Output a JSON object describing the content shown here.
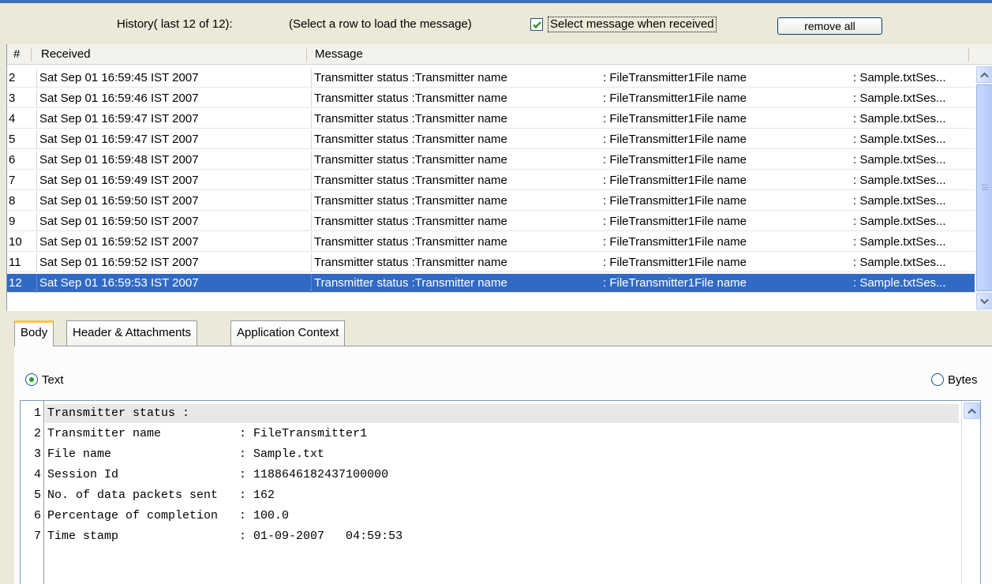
{
  "history": {
    "title": "History( last 12 of 12):",
    "hint": "(Select a row to load the message)",
    "select_checkbox_label": "Select message when received",
    "select_checked": true,
    "remove_all_label": "remove all"
  },
  "table": {
    "columns": [
      "#",
      "Received",
      "Message"
    ],
    "rows": [
      {
        "num": "2",
        "received": "Sat Sep 01 16:59:45 IST 2007",
        "m1": "Transmitter status :Transmitter name",
        "m2": ": FileTransmitter1File name",
        "m3": ": Sample.txtSes..."
      },
      {
        "num": "3",
        "received": "Sat Sep 01 16:59:46 IST 2007",
        "m1": "Transmitter status :Transmitter name",
        "m2": ": FileTransmitter1File name",
        "m3": ": Sample.txtSes..."
      },
      {
        "num": "4",
        "received": "Sat Sep 01 16:59:47 IST 2007",
        "m1": "Transmitter status :Transmitter name",
        "m2": ": FileTransmitter1File name",
        "m3": ": Sample.txtSes..."
      },
      {
        "num": "5",
        "received": "Sat Sep 01 16:59:47 IST 2007",
        "m1": "Transmitter status :Transmitter name",
        "m2": ": FileTransmitter1File name",
        "m3": ": Sample.txtSes..."
      },
      {
        "num": "6",
        "received": "Sat Sep 01 16:59:48 IST 2007",
        "m1": "Transmitter status :Transmitter name",
        "m2": ": FileTransmitter1File name",
        "m3": ": Sample.txtSes..."
      },
      {
        "num": "7",
        "received": "Sat Sep 01 16:59:49 IST 2007",
        "m1": "Transmitter status :Transmitter name",
        "m2": ": FileTransmitter1File name",
        "m3": ": Sample.txtSes..."
      },
      {
        "num": "8",
        "received": "Sat Sep 01 16:59:50 IST 2007",
        "m1": "Transmitter status :Transmitter name",
        "m2": ": FileTransmitter1File name",
        "m3": ": Sample.txtSes..."
      },
      {
        "num": "9",
        "received": "Sat Sep 01 16:59:50 IST 2007",
        "m1": "Transmitter status :Transmitter name",
        "m2": ": FileTransmitter1File name",
        "m3": ": Sample.txtSes..."
      },
      {
        "num": "10",
        "received": "Sat Sep 01 16:59:52 IST 2007",
        "m1": "Transmitter status :Transmitter name",
        "m2": ": FileTransmitter1File name",
        "m3": ": Sample.txtSes..."
      },
      {
        "num": "11",
        "received": "Sat Sep 01 16:59:52 IST 2007",
        "m1": "Transmitter status :Transmitter name",
        "m2": ": FileTransmitter1File name",
        "m3": ": Sample.txtSes..."
      },
      {
        "num": "12",
        "received": "Sat Sep 01 16:59:53 IST 2007",
        "m1": "Transmitter status :Transmitter name",
        "m2": ": FileTransmitter1File name",
        "m3": ": Sample.txtSes...",
        "selected": true
      }
    ]
  },
  "tabs": [
    {
      "label": "Body",
      "active": true
    },
    {
      "label": "Header & Attachments",
      "active": false
    },
    {
      "label": "Application Context",
      "active": false
    }
  ],
  "format": {
    "text_label": "Text",
    "bytes_label": "Bytes",
    "selected": "Text"
  },
  "body": {
    "lines": [
      {
        "num": "1",
        "text": "Transmitter status :"
      },
      {
        "num": "2",
        "text": "Transmitter name           : FileTransmitter1"
      },
      {
        "num": "3",
        "text": "File name                  : Sample.txt"
      },
      {
        "num": "4",
        "text": "Session Id                 : 1188646182437100000"
      },
      {
        "num": "5",
        "text": "No. of data packets sent   : 162"
      },
      {
        "num": "6",
        "text": "Percentage of completion   : 100.0"
      },
      {
        "num": "7",
        "text": "Time stamp                 : 01-09-2007   04:59:53"
      }
    ]
  },
  "colors": {
    "selection": "#316ac5",
    "tab_highlight": "#ffc83c",
    "checkmark": "#21a121"
  }
}
